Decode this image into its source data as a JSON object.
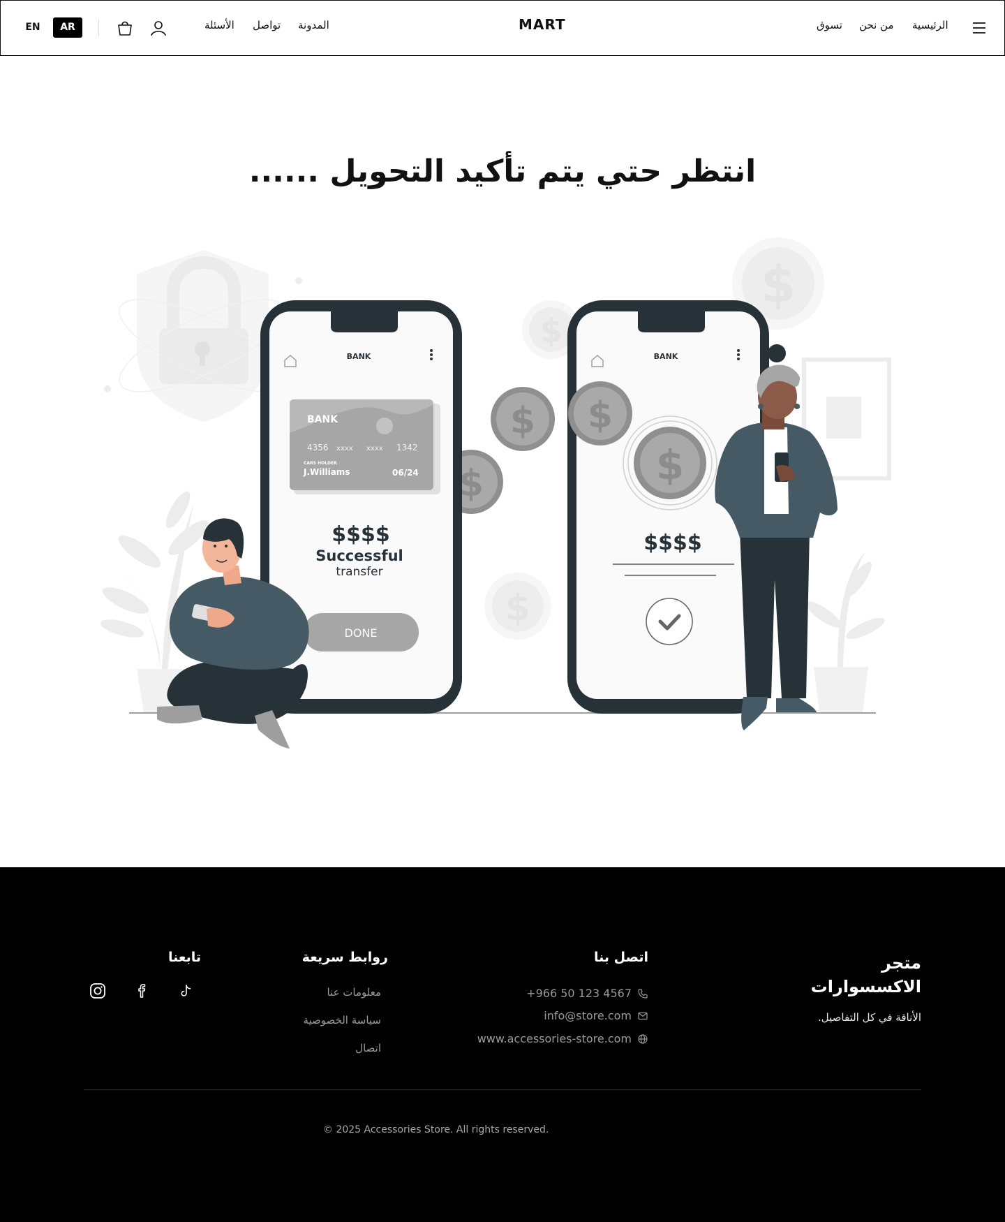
{
  "header": {
    "lang_en": "EN",
    "lang_ar": "AR",
    "logo": "MART",
    "nav_left": [
      "الأسئلة",
      "تواصل",
      "المدونة"
    ],
    "nav_right": [
      "تسوق",
      "من نحن",
      "الرئيسية"
    ],
    "icons": [
      "shopping-bag-icon",
      "user-icon",
      "menu-icon"
    ]
  },
  "main": {
    "title": "انتظر حتي يتم تأكيد التحويل ......",
    "illustration": {
      "phone_left": {
        "app_title": "BANK",
        "card": {
          "bank": "BANK",
          "number": [
            "4356",
            "xxxx",
            "xxxx",
            "1342"
          ],
          "holder_label": "CARS HOLDER",
          "holder": "J.Williams",
          "expiry": "06/24"
        },
        "amount": "$$$$",
        "status": "Successful",
        "status_sub": "transfer",
        "button": "DONE"
      },
      "phone_right": {
        "app_title": "BANK",
        "amount": "$$$$"
      }
    }
  },
  "footer": {
    "brand_line1": "متجر",
    "brand_line2": "الاكسسوارات",
    "tagline": "الأناقة في كل التفاصيل.",
    "contact": {
      "title": "اتصل بنا",
      "phone": "+966 50 123 4567",
      "email": "info@store.com",
      "website": "www.accessories-store.com"
    },
    "links": {
      "title": "روابط سريعة",
      "items": [
        "معلومات عنا",
        "سياسة الخصوصية",
        "اتصال"
      ]
    },
    "follow": {
      "title": "تابعنا",
      "icons": [
        "instagram-icon",
        "facebook-icon",
        "tiktok-icon"
      ]
    },
    "copyright": "© 2025 Accessories Store. All rights reserved."
  },
  "colors": {
    "dark": "#263238",
    "jacket": "#455a64",
    "accent_gray": "#a6a6a6",
    "footer_bg": "#000000"
  }
}
